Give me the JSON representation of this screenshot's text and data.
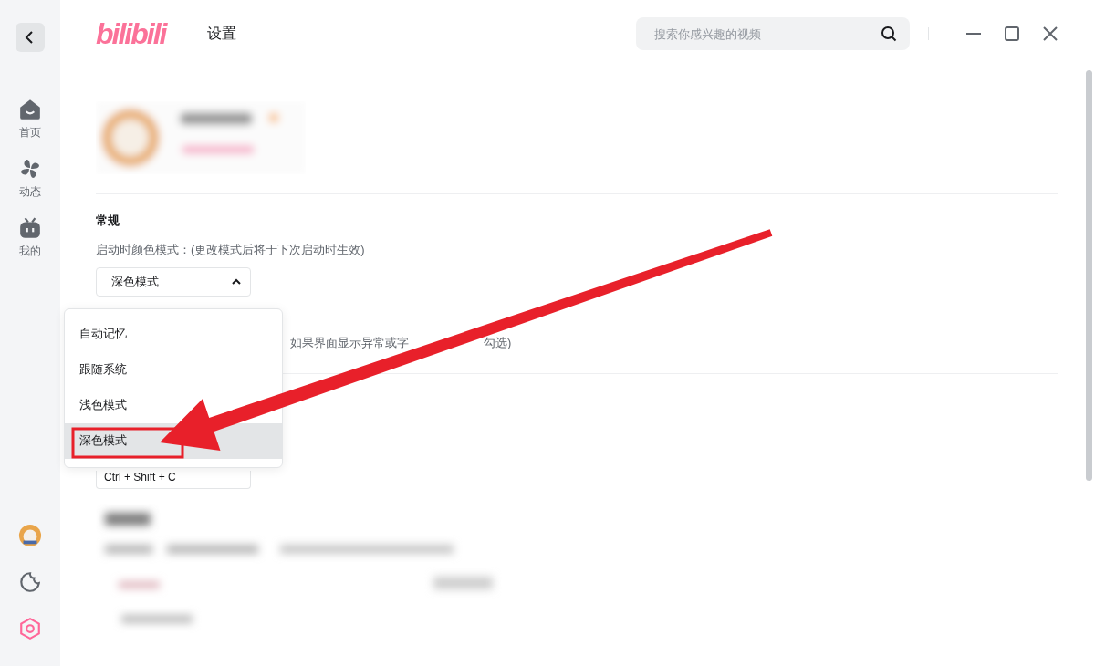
{
  "sidebar": {
    "nav_items": [
      {
        "label": "首页",
        "selected": false
      },
      {
        "label": "动态",
        "selected": false
      },
      {
        "label": "我的",
        "selected": false
      }
    ],
    "bottom_items": [
      {
        "kind": "avatar",
        "selected": false
      },
      {
        "kind": "theme",
        "selected": false
      },
      {
        "kind": "settings",
        "selected": true
      }
    ]
  },
  "header": {
    "logo": "bilibili",
    "title": "设置",
    "search": {
      "placeholder": "搜索你感兴趣的视频"
    }
  },
  "general": {
    "heading": "常规",
    "color_mode_label": "启动时颜色模式：(更改模式后将于下次启动时生效)",
    "select": {
      "value": "深色模式",
      "expanded": true
    },
    "menu": [
      {
        "label": "自动记忆",
        "selected": false
      },
      {
        "label": "跟随系统",
        "selected": false
      },
      {
        "label": "浅色模式",
        "selected": false
      },
      {
        "label": "深色模式",
        "selected": true
      }
    ],
    "hint_parts": [
      "如果界面显示异常或字",
      "勾选)"
    ],
    "shortcut": "Ctrl + Shift + C"
  }
}
